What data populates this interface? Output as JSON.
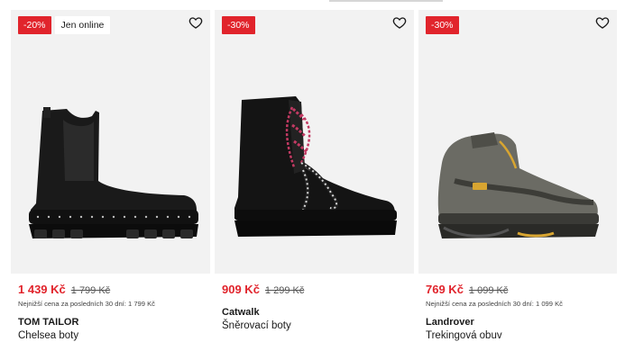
{
  "products": [
    {
      "discount": "-20%",
      "tag": "Jen online",
      "price": "1 439 Kč",
      "old_price": "1 799 Kč",
      "lowest_note": "Nejnižší cena za posledních 30 dní: 1 799 Kč",
      "brand": "TOM TAILOR",
      "title": "Chelsea boty",
      "icon": "heart-icon"
    },
    {
      "discount": "-30%",
      "price": "909 Kč",
      "old_price": "1 299 Kč",
      "brand": "Catwalk",
      "title": "Šněrovací boty",
      "icon": "heart-icon"
    },
    {
      "discount": "-30%",
      "price": "769 Kč",
      "old_price": "1 099 Kč",
      "lowest_note": "Nejnižší cena za posledních 30 dní: 1 099 Kč",
      "brand": "Landrover",
      "title": "Trekingová obuv",
      "icon": "heart-icon"
    }
  ],
  "colors": {
    "accent": "#e1242c",
    "image_bg": "#f2f2f2"
  }
}
